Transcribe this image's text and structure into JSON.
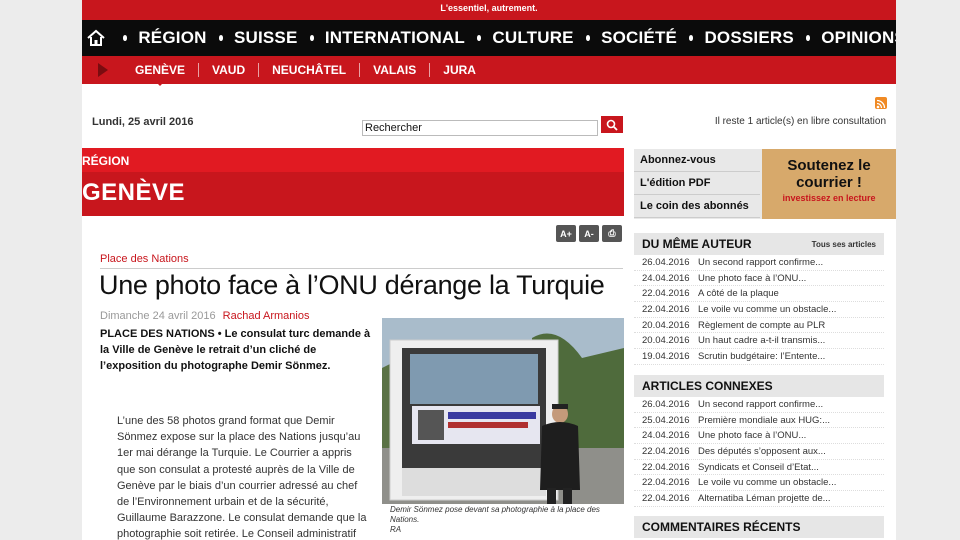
{
  "header": {
    "tagline": "L'essentiel, autrement."
  },
  "main_nav": [
    "RÉGION",
    "SUISSE",
    "INTERNATIONAL",
    "CULTURE",
    "SOCIÉTÉ",
    "DOSSIERS",
    "OPINIONS"
  ],
  "sub_nav": [
    "GENÈVE",
    "VAUD",
    "NEUCHÂTEL",
    "VALAIS",
    "JURA"
  ],
  "toolbar": {
    "date": "Lundi, 25 avril 2016",
    "search_value": "Rechercher",
    "free_articles": "Il reste 1 article(s) en libre consultation"
  },
  "section": {
    "label": "RÉGION",
    "title": "GENÈVE"
  },
  "article": {
    "tools": [
      "A+",
      "A-",
      "⎙"
    ],
    "kicker": "Place des Nations",
    "headline": "Une photo face à l’ONU dérange la Turquie",
    "date": "Dimanche 24 avril 2016",
    "author": "Rachad Armanios",
    "lead": "PLACE DES NATIONS • Le consulat turc demande à la Ville de Genève le retrait d’un cliché de l’exposition du photographe Demir Sönmez.",
    "body": "L’une des 58 photos grand format que Demir Sönmez expose sur la place des Nations jusqu’au 1er mai dérange la Turquie. Le Courrier a appris que son consulat a protesté auprès de la Ville de Genève par le biais d’un courrier adressé au chef de l’Environnement urbain et de la sécurité, Guillaume Barazzone. Le consulat demande que la photographie soit retirée. Le Conseil administratif discutera mardi",
    "photo_caption": "Demir Sönmez pose devant sa photographie à la place des Nations.",
    "photo_credit": "RA"
  },
  "promo": {
    "links": [
      "Abonnez-vous",
      "L'édition PDF",
      "Le coin des abonnés"
    ],
    "card_title": "Soutenez le courrier !",
    "card_sub": "investissez en lecture"
  },
  "same_author": {
    "title": "DU MÊME AUTEUR",
    "link": "Tous ses articles",
    "items": [
      {
        "date": "26.04.2016",
        "text": "Un second rapport confirme..."
      },
      {
        "date": "24.04.2016",
        "text": "Une photo face à l’ONU..."
      },
      {
        "date": "22.04.2016",
        "text": "A côté de la plaque"
      },
      {
        "date": "22.04.2016",
        "text": "Le voile vu comme un obstacle..."
      },
      {
        "date": "20.04.2016",
        "text": "Règlement de compte au PLR"
      },
      {
        "date": "20.04.2016",
        "text": "Un haut cadre a-t-il transmis..."
      },
      {
        "date": "19.04.2016",
        "text": "Scrutin budgétaire: l’Entente..."
      }
    ]
  },
  "related": {
    "title": "ARTICLES CONNEXES",
    "items": [
      {
        "date": "26.04.2016",
        "text": "Un second rapport confirme..."
      },
      {
        "date": "25.04.2016",
        "text": "Première mondiale aux HUG:..."
      },
      {
        "date": "24.04.2016",
        "text": "Une photo face à l’ONU..."
      },
      {
        "date": "22.04.2016",
        "text": "Des députés s’opposent aux..."
      },
      {
        "date": "22.04.2016",
        "text": "Syndicats et Conseil d’Etat..."
      },
      {
        "date": "22.04.2016",
        "text": "Le voile vu comme un obstacle..."
      },
      {
        "date": "22.04.2016",
        "text": "Alternatiba Léman projette de..."
      }
    ]
  },
  "comments": {
    "title": "COMMENTAIRES RÉCENTS"
  },
  "colors": {
    "brand_red": "#c8161d",
    "nav_black": "#0b0b0b",
    "promo_gold": "#d7a96b"
  },
  "icons": {
    "home": "home-icon",
    "search": "search-icon",
    "rss": "rss-icon"
  }
}
